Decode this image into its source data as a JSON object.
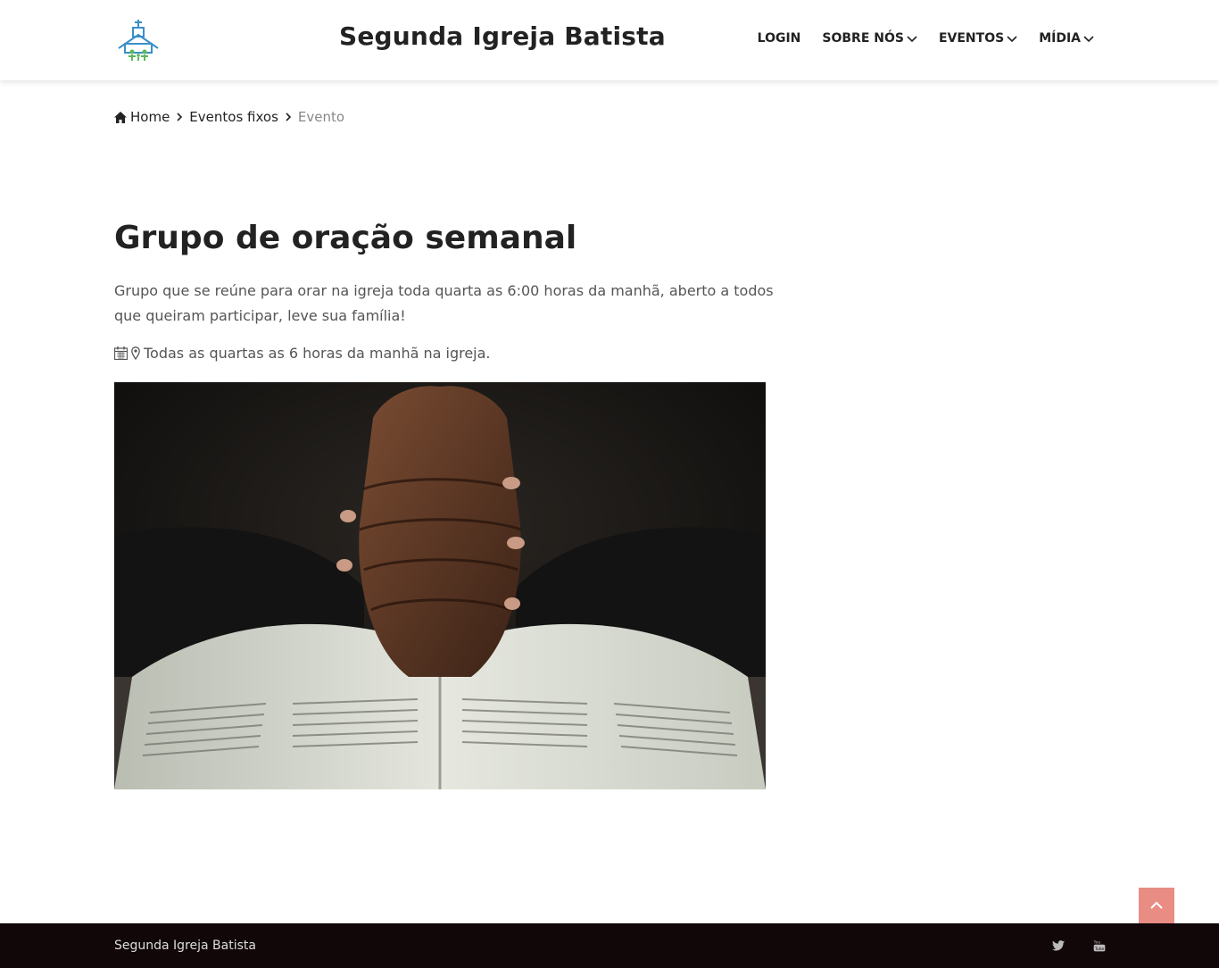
{
  "header": {
    "site_title": "Segunda Igreja Batista",
    "logo_icon": "church-family-logo",
    "nav": [
      {
        "label": "LOGIN",
        "dropdown": false
      },
      {
        "label": "SOBRE NÓS",
        "dropdown": true
      },
      {
        "label": "EVENTOS",
        "dropdown": true
      },
      {
        "label": "MÍDIA",
        "dropdown": true
      }
    ]
  },
  "breadcrumb": {
    "home": "Home",
    "section": "Eventos fixos",
    "current": "Evento"
  },
  "event": {
    "title": "Grupo de oração semanal",
    "description": "Grupo que se reúne para orar na igreja toda quarta as 6:00 horas da manhã, aberto a todos que queiram participar, leve sua família!",
    "schedule": "Todas as quartas as 6 horas da manhã na igreja.",
    "image_icon": "praying-hands-bible-photo"
  },
  "footer": {
    "text": "Segunda Igreja Batista",
    "social": [
      "twitter-icon",
      "youtube-icon"
    ]
  },
  "colors": {
    "accent": "#e88c84",
    "footer_bg": "#110709",
    "logo_blue": "#3a8fc9",
    "logo_green": "#5cb85c"
  }
}
